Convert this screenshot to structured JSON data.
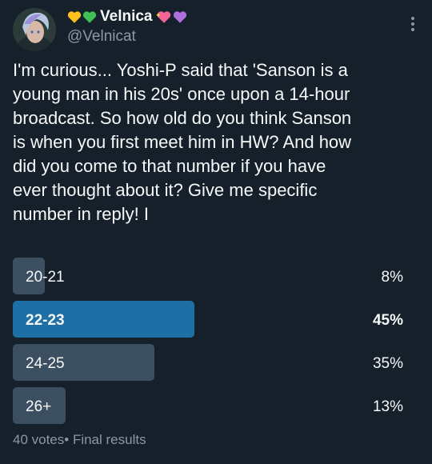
{
  "author": {
    "display_name": "Velnica",
    "handle": "@Velnicat",
    "avatar_icon": "avatar-image"
  },
  "tweet": {
    "text": "I'm curious... Yoshi-P said that 'Sanson is a\nyoung man in his 20s' once upon a 14-hour\nbroadcast. So how old do you think Sanson\nis when you first meet him in HW? And how\ndid you come to that number if you have\never thought about it? Give me specific\nnumber in reply! I"
  },
  "poll": {
    "options": [
      {
        "label": "20-21",
        "percent_text": "8%",
        "percent": 8,
        "winner": false
      },
      {
        "label": "22-23",
        "percent_text": "45%",
        "percent": 45,
        "winner": true
      },
      {
        "label": "24-25",
        "percent_text": "35%",
        "percent": 35,
        "winner": false
      },
      {
        "label": "26+",
        "percent_text": "13%",
        "percent": 13,
        "winner": false
      }
    ],
    "footer": "40 votes• Final results"
  },
  "colors": {
    "background": "#15202b",
    "winner_fill": "#1d6fa5",
    "option_fill": "#3c4f61",
    "secondary_text": "#8b98a5"
  }
}
